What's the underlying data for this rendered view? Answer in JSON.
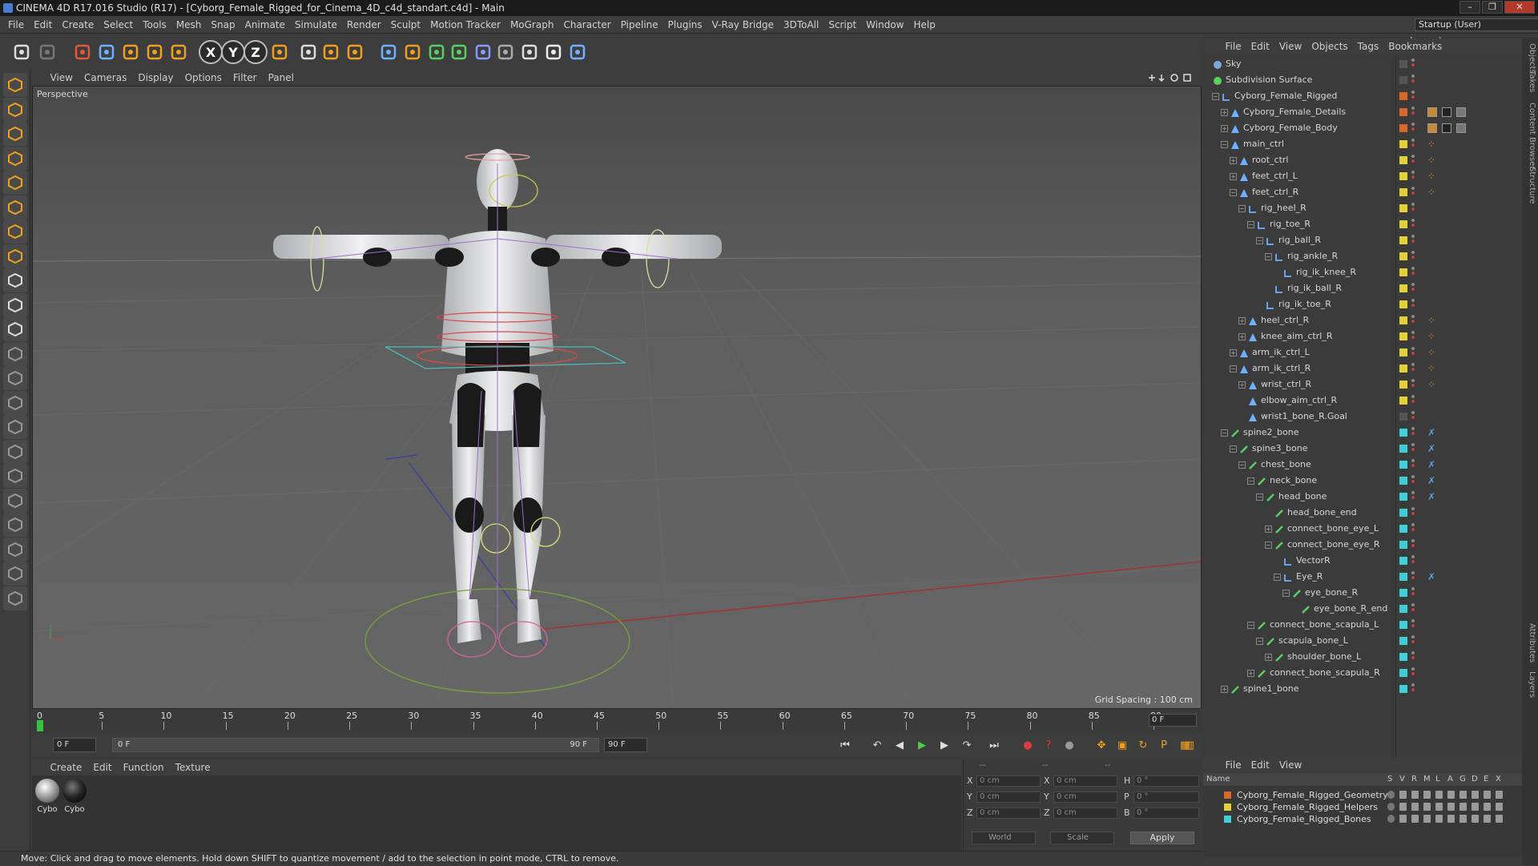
{
  "window": {
    "title": "CINEMA 4D R17.016 Studio (R17) - [Cyborg_Female_Rigged_for_Cinema_4D_c4d_standart.c4d] - Main",
    "controls": [
      "–",
      "❐",
      "✕"
    ]
  },
  "menubar": {
    "items": [
      "File",
      "Edit",
      "Create",
      "Select",
      "Tools",
      "Mesh",
      "Snap",
      "Animate",
      "Simulate",
      "Render",
      "Sculpt",
      "Motion Tracker",
      "MoGraph",
      "Character",
      "Pipeline",
      "Plugins",
      "V-Ray Bridge",
      "3DToAll",
      "Script",
      "Window",
      "Help"
    ],
    "layout_label": "Layout:",
    "layout_value": "Startup (User)"
  },
  "toolbar": {
    "icons": [
      "undo-icon",
      "redo-icon",
      "live-selection-icon",
      "move-icon",
      "scale-icon",
      "rotate-icon",
      "recent-tool-icon",
      "x-axis-icon",
      "y-axis-icon",
      "z-axis-icon",
      "coordinate-system-icon",
      "render-view-icon",
      "render-picture-viewer-icon",
      "render-settings-icon",
      "cube-icon",
      "pen-spline-icon",
      "subdivision-icon",
      "array-icon",
      "deformer-icon",
      "floor-icon",
      "camera-icon",
      "light-icon",
      "python-icon"
    ],
    "axis_labels": [
      "X",
      "Y",
      "Z"
    ]
  },
  "left_tools": [
    "make-editable-icon",
    "model-mode-icon",
    "texture-mode-icon",
    "workplane-mode-icon",
    "points-mode-icon",
    "edges-mode-icon",
    "polygons-mode-icon",
    "axis-mode-icon",
    "tweak-mode-icon",
    "solo-icon",
    "snap-icon",
    "workplane-icon",
    "sculpt-brush-1-icon",
    "sculpt-brush-2-icon",
    "sculpt-brush-3-icon",
    "sculpt-brush-4-icon",
    "sculpt-brush-5-icon",
    "sculpt-brush-6-icon",
    "sculpt-brush-7-icon",
    "lock-workplane-icon",
    "grid-icon",
    "python-script-icon"
  ],
  "viewport": {
    "menu": [
      "View",
      "Cameras",
      "Display",
      "Options",
      "Filter",
      "Panel"
    ],
    "label": "Perspective",
    "grid_spacing": "Grid Spacing : 100 cm"
  },
  "timeline": {
    "ticks": [
      "0",
      "5",
      "10",
      "15",
      "20",
      "25",
      "30",
      "35",
      "40",
      "45",
      "50",
      "55",
      "60",
      "65",
      "70",
      "75",
      "80",
      "85",
      "90"
    ],
    "current_frame_readout": "0 F",
    "playhead_frame": 0
  },
  "transport": {
    "start_field": "0 F",
    "range_start": "0 F",
    "range_end": "90 F",
    "end_field": "90 F",
    "buttons": [
      "go-to-start-icon",
      "previous-key-icon",
      "previous-frame-icon",
      "play-icon",
      "next-frame-icon",
      "next-key-icon",
      "go-to-end-icon",
      "record-icon",
      "autokey-icon",
      "keyframe-selection-icon",
      "position-key-icon",
      "scale-key-icon",
      "rotation-key-icon",
      "parameter-key-icon",
      "pla-key-icon",
      "timeline-icon"
    ]
  },
  "materials": {
    "menu": [
      "Create",
      "Edit",
      "Function",
      "Texture"
    ],
    "items": [
      {
        "label": "Cybo"
      },
      {
        "label": "Cybo"
      }
    ]
  },
  "coordinates": {
    "header": [
      "--",
      "--",
      "--"
    ],
    "rows": [
      {
        "a": "X",
        "av": "0 cm",
        "b": "X",
        "bv": "0 cm",
        "c": "H",
        "cv": "0 °"
      },
      {
        "a": "Y",
        "av": "0 cm",
        "b": "Y",
        "bv": "0 cm",
        "c": "P",
        "cv": "0 °"
      },
      {
        "a": "Z",
        "av": "0 cm",
        "b": "Z",
        "bv": "0 cm",
        "c": "B",
        "cv": "0 °"
      }
    ],
    "space": "World",
    "mode": "Scale",
    "apply": "Apply"
  },
  "statusbar": {
    "text": "Move: Click and drag to move elements. Hold down SHIFT to quantize movement / add to the selection in point mode, CTRL to remove."
  },
  "objects_panel": {
    "menu": [
      "File",
      "Edit",
      "View",
      "Objects",
      "Tags",
      "Bookmarks"
    ],
    "rows": [
      {
        "name": "Sky",
        "depth": 0,
        "icon": "sky",
        "exp": "",
        "layer": "none"
      },
      {
        "name": "Subdivision Surface",
        "depth": 0,
        "icon": "subdiv",
        "exp": "",
        "layer": "none"
      },
      {
        "name": "Cyborg_Female_Rigged",
        "depth": 1,
        "icon": "null",
        "exp": "-",
        "layer": "#d9682a"
      },
      {
        "name": "Cyborg_Female_Details",
        "depth": 2,
        "icon": "poly",
        "exp": "+",
        "layer": "#d9682a"
      },
      {
        "name": "Cyborg_Female_Body",
        "depth": 2,
        "icon": "poly",
        "exp": "+",
        "layer": "#d9682a"
      },
      {
        "name": "main_ctrl",
        "depth": 2,
        "icon": "ctrl",
        "exp": "-",
        "layer": "#e2d23a"
      },
      {
        "name": "root_ctrl",
        "depth": 3,
        "icon": "ctrl",
        "exp": "+",
        "layer": "#e2d23a"
      },
      {
        "name": "feet_ctrl_L",
        "depth": 3,
        "icon": "ctrl",
        "exp": "+",
        "layer": "#e2d23a"
      },
      {
        "name": "feet_ctrl_R",
        "depth": 3,
        "icon": "ctrl",
        "exp": "-",
        "layer": "#e2d23a"
      },
      {
        "name": "rig_heel_R",
        "depth": 4,
        "icon": "null",
        "exp": "-",
        "layer": "#e2d23a"
      },
      {
        "name": "rig_toe_R",
        "depth": 5,
        "icon": "null",
        "exp": "-",
        "layer": "#e2d23a"
      },
      {
        "name": "rig_ball_R",
        "depth": 6,
        "icon": "null",
        "exp": "-",
        "layer": "#e2d23a"
      },
      {
        "name": "rig_ankle_R",
        "depth": 7,
        "icon": "null",
        "exp": "-",
        "layer": "#e2d23a"
      },
      {
        "name": "rig_ik_knee_R",
        "depth": 8,
        "icon": "null",
        "exp": "",
        "layer": "#e2d23a"
      },
      {
        "name": "rig_ik_ball_R",
        "depth": 7,
        "icon": "null",
        "exp": "",
        "layer": "#e2d23a"
      },
      {
        "name": "rig_ik_toe_R",
        "depth": 6,
        "icon": "null",
        "exp": "",
        "layer": "#e2d23a"
      },
      {
        "name": "heel_ctrl_R",
        "depth": 4,
        "icon": "ctrl",
        "exp": "+",
        "layer": "#e2d23a"
      },
      {
        "name": "knee_aim_ctrl_R",
        "depth": 4,
        "icon": "ctrl",
        "exp": "+",
        "layer": "#e2d23a"
      },
      {
        "name": "arm_ik_ctrl_L",
        "depth": 3,
        "icon": "ctrl",
        "exp": "+",
        "layer": "#e2d23a"
      },
      {
        "name": "arm_ik_ctrl_R",
        "depth": 3,
        "icon": "ctrl",
        "exp": "-",
        "layer": "#e2d23a"
      },
      {
        "name": "wrist_ctrl_R",
        "depth": 4,
        "icon": "ctrl",
        "exp": "+",
        "layer": "#e2d23a"
      },
      {
        "name": "elbow_aim_ctrl_R",
        "depth": 4,
        "icon": "ctrl",
        "exp": "",
        "layer": "#e2d23a"
      },
      {
        "name": "wrist1_bone_R.Goal",
        "depth": 4,
        "icon": "ctrl",
        "exp": "",
        "layer": "none"
      },
      {
        "name": "spine2_bone",
        "depth": 2,
        "icon": "bone",
        "exp": "-",
        "layer": "#3fd0d8"
      },
      {
        "name": "spine3_bone",
        "depth": 3,
        "icon": "bone",
        "exp": "-",
        "layer": "#3fd0d8"
      },
      {
        "name": "chest_bone",
        "depth": 4,
        "icon": "bone",
        "exp": "-",
        "layer": "#3fd0d8"
      },
      {
        "name": "neck_bone",
        "depth": 5,
        "icon": "bone",
        "exp": "-",
        "layer": "#3fd0d8"
      },
      {
        "name": "head_bone",
        "depth": 6,
        "icon": "bone",
        "exp": "-",
        "layer": "#3fd0d8"
      },
      {
        "name": "head_bone_end",
        "depth": 7,
        "icon": "bone",
        "exp": "",
        "layer": "#3fd0d8"
      },
      {
        "name": "connect_bone_eye_L",
        "depth": 7,
        "icon": "bone",
        "exp": "+",
        "layer": "#3fd0d8"
      },
      {
        "name": "connect_bone_eye_R",
        "depth": 7,
        "icon": "bone",
        "exp": "-",
        "layer": "#3fd0d8"
      },
      {
        "name": "VectorR",
        "depth": 8,
        "icon": "null",
        "exp": "",
        "layer": "#3fd0d8"
      },
      {
        "name": "Eye_R",
        "depth": 8,
        "icon": "null",
        "exp": "-",
        "layer": "#3fd0d8"
      },
      {
        "name": "eye_bone_R",
        "depth": 9,
        "icon": "bone",
        "exp": "-",
        "layer": "#3fd0d8"
      },
      {
        "name": "eye_bone_R_end",
        "depth": 10,
        "icon": "bone",
        "exp": "",
        "layer": "#3fd0d8"
      },
      {
        "name": "connect_bone_scapula_L",
        "depth": 5,
        "icon": "bone",
        "exp": "-",
        "layer": "#3fd0d8"
      },
      {
        "name": "scapula_bone_L",
        "depth": 6,
        "icon": "bone",
        "exp": "-",
        "layer": "#3fd0d8"
      },
      {
        "name": "shoulder_bone_L",
        "depth": 7,
        "icon": "bone",
        "exp": "+",
        "layer": "#3fd0d8"
      },
      {
        "name": "connect_bone_scapula_R",
        "depth": 5,
        "icon": "bone",
        "exp": "+",
        "layer": "#3fd0d8"
      },
      {
        "name": "spine1_bone",
        "depth": 2,
        "icon": "bone",
        "exp": "+",
        "layer": "#3fd0d8"
      }
    ]
  },
  "right_tabs": [
    "Objects",
    "Takes",
    "Content Browser",
    "Structure",
    "Attributes",
    "Layers"
  ],
  "layers_panel": {
    "menu": [
      "File",
      "Edit",
      "View"
    ],
    "header_name": "Name",
    "header_cols": [
      "S",
      "V",
      "R",
      "M",
      "L",
      "A",
      "G",
      "D",
      "E",
      "X"
    ],
    "rows": [
      {
        "name": "Cyborg_Female_Rigged_Geometry",
        "color": "#d9682a"
      },
      {
        "name": "Cyborg_Female_Rigged_Helpers",
        "color": "#e2d23a"
      },
      {
        "name": "Cyborg_Female_Rigged_Bones",
        "color": "#3fd0d8"
      }
    ]
  }
}
